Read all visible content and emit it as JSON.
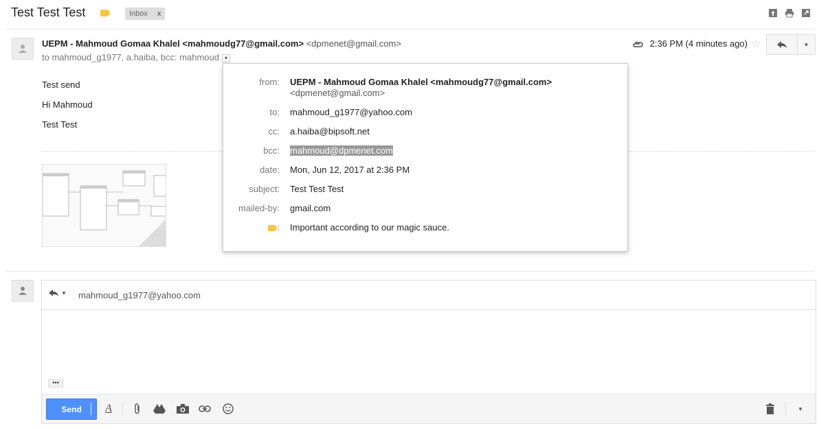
{
  "thread": {
    "subject": "Test Test Test",
    "label": "Inbox",
    "label_close": "x"
  },
  "message": {
    "sender_name": "UEPM - Mahmoud Gomaa Khalel <mahmoudg77@gmail.com>",
    "sender_via": "<dpmenet@gmail.com>",
    "recipients": "to mahmoud_g1977, a.haiba, bcc: mahmoud",
    "time": "2:36 PM (4 minutes ago)",
    "body": [
      "Test send",
      "Hi Mahmoud",
      "Test Test"
    ]
  },
  "details": {
    "from_label": "from:",
    "from_name": "UEPM - Mahmoud Gomaa Khalel <mahmoudg77@gmail.com>",
    "from_email": "<dpmenet@gmail.com>",
    "to_label": "to:",
    "to_value": "mahmoud_g1977@yahoo.com",
    "cc_label": "cc:",
    "cc_value": "a.haiba@bipsoft.net",
    "bcc_label": "bcc:",
    "bcc_value": "mahmoud@dpmenet.com",
    "date_label": "date:",
    "date_value": "Mon, Jun 12, 2017 at 2:36 PM",
    "subject_label": "subject:",
    "subject_value": "Test Test Test",
    "mailedby_label": "mailed-by:",
    "mailedby_value": "gmail.com",
    "importance_label": ":",
    "importance_value": "Important according to our magic sauce."
  },
  "compose": {
    "to": "mahmoud_g1977@yahoo.com",
    "send_label": "Send",
    "ellipsis": "•••"
  },
  "colors": {
    "label_yellow": "#f8c545",
    "send_blue": "#4d90fe"
  },
  "icons": [
    "label-icon",
    "archive-icon",
    "print-icon",
    "new-window-icon",
    "attachment-icon",
    "star-icon",
    "reply-icon",
    "more-icon",
    "format-text-icon",
    "attach-file-icon",
    "drive-icon",
    "photo-icon",
    "link-icon",
    "emoji-icon",
    "trash-icon"
  ]
}
